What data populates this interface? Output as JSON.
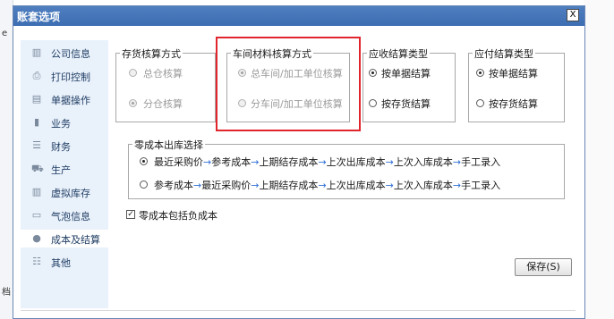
{
  "window": {
    "title": "账套选项",
    "close_label": "X"
  },
  "sidebar": {
    "items": [
      {
        "label": "公司信息",
        "icon": "building-icon"
      },
      {
        "label": "打印控制",
        "icon": "printer-icon"
      },
      {
        "label": "单据操作",
        "icon": "document-icon"
      },
      {
        "label": "业务",
        "icon": "chart-icon"
      },
      {
        "label": "财务",
        "icon": "database-icon"
      },
      {
        "label": "生产",
        "icon": "cart-icon"
      },
      {
        "label": "虚拟库存",
        "icon": "building-icon"
      },
      {
        "label": "气泡信息",
        "icon": "monitor-icon"
      },
      {
        "label": "成本及结算",
        "icon": "droplet-icon",
        "active": true
      },
      {
        "label": "其他",
        "icon": "list-icon"
      }
    ]
  },
  "inventory_method": {
    "title": "存货核算方式",
    "options": [
      {
        "label": "总仓核算",
        "checked": false,
        "disabled": true
      },
      {
        "label": "分仓核算",
        "checked": true,
        "disabled": true
      }
    ]
  },
  "workshop_method": {
    "title": "车间材料核算方式",
    "options": [
      {
        "label": "总车间/加工单位核算",
        "checked": true,
        "disabled": true
      },
      {
        "label": "分车间/加工单位核算",
        "checked": false,
        "disabled": true
      }
    ]
  },
  "receivable_type": {
    "title": "应收结算类型",
    "options": [
      {
        "label": "按单据结算",
        "checked": true,
        "disabled": false
      },
      {
        "label": "按存货结算",
        "checked": false,
        "disabled": false
      }
    ]
  },
  "payable_type": {
    "title": "应付结算类型",
    "options": [
      {
        "label": "按单据结算",
        "checked": true,
        "disabled": false
      },
      {
        "label": "按存货结算",
        "checked": false,
        "disabled": false
      }
    ]
  },
  "zero_cost": {
    "title": "零成本出库选择",
    "option1": {
      "checked": true,
      "parts": [
        "最近采购价",
        "参考成本",
        "上期结存成本",
        "上次出库成本",
        "上次入库成本",
        "手工录入"
      ]
    },
    "option2": {
      "checked": false,
      "parts": [
        "参考成本",
        "最近采购价",
        "上期结存成本",
        "上次出库成本",
        "上次入库成本",
        "手工录入"
      ]
    },
    "arrow": "→"
  },
  "include_negative": {
    "label": "零成本包括负成本",
    "checked": true,
    "mark": "✓"
  },
  "save_button": {
    "label": "保存(S)"
  },
  "edge": {
    "left_char": "e",
    "bottom_char": "档"
  },
  "colors": {
    "titlebar": "#3d6db2",
    "highlight": "#e0262c",
    "arrow": "#2f6fd6",
    "sidebar": "#e9f1fb"
  }
}
